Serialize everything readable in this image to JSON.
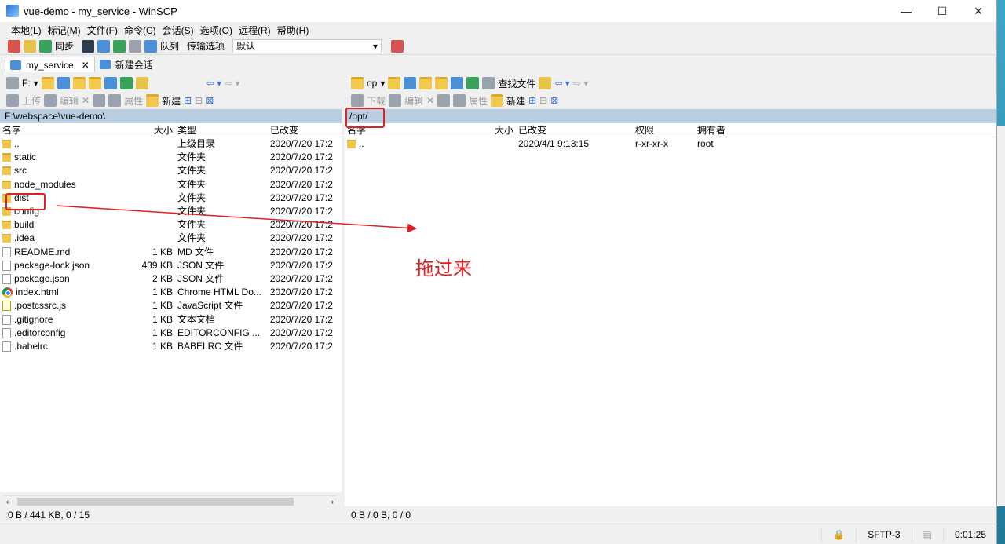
{
  "window": {
    "title": "vue-demo - my_service - WinSCP",
    "minimize": "—",
    "maximize": "☐",
    "close": "✕"
  },
  "menu": [
    "本地(L)",
    "标记(M)",
    "文件(F)",
    "命令(C)",
    "会话(S)",
    "选项(O)",
    "远程(R)",
    "帮助(H)"
  ],
  "toolbar": {
    "sync_label": "同步",
    "queue_label": "队列",
    "transfer_label": "传输选项",
    "transfer_value": "默认"
  },
  "tabs": [
    {
      "label": "my_service",
      "close": "✕"
    },
    {
      "label": "新建会话"
    }
  ],
  "left": {
    "drive": "F:",
    "upload": "上传",
    "edit": "编辑",
    "properties": "属性",
    "new": "新建",
    "path": "F:\\webspace\\vue-demo\\",
    "columns": [
      "名字",
      "大小",
      "类型",
      "已改变"
    ],
    "rows": [
      {
        "name": "..",
        "size": "",
        "type": "上级目录",
        "changed": "2020/7/20  17:2",
        "icon": "parent-icon"
      },
      {
        "name": "static",
        "size": "",
        "type": "文件夹",
        "changed": "2020/7/20  17:2",
        "icon": "folder-icon"
      },
      {
        "name": "src",
        "size": "",
        "type": "文件夹",
        "changed": "2020/7/20  17:2",
        "icon": "folder-icon"
      },
      {
        "name": "node_modules",
        "size": "",
        "type": "文件夹",
        "changed": "2020/7/20  17:2",
        "icon": "folder-icon"
      },
      {
        "name": "dist",
        "size": "",
        "type": "文件夹",
        "changed": "2020/7/20  17:2",
        "icon": "folder-icon"
      },
      {
        "name": "config",
        "size": "",
        "type": "文件夹",
        "changed": "2020/7/20  17:2",
        "icon": "folder-icon"
      },
      {
        "name": "build",
        "size": "",
        "type": "文件夹",
        "changed": "2020/7/20  17:2",
        "icon": "folder-icon"
      },
      {
        "name": ".idea",
        "size": "",
        "type": "文件夹",
        "changed": "2020/7/20  17:2",
        "icon": "folder-icon"
      },
      {
        "name": "README.md",
        "size": "1 KB",
        "type": "MD 文件",
        "changed": "2020/7/20  17:2",
        "icon": "file-icon"
      },
      {
        "name": "package-lock.json",
        "size": "439 KB",
        "type": "JSON 文件",
        "changed": "2020/7/20  17:2",
        "icon": "file-icon"
      },
      {
        "name": "package.json",
        "size": "2 KB",
        "type": "JSON 文件",
        "changed": "2020/7/20  17:2",
        "icon": "file-icon"
      },
      {
        "name": "index.html",
        "size": "1 KB",
        "type": "Chrome HTML Do...",
        "changed": "2020/7/20  17:2",
        "icon": "chrome-icon"
      },
      {
        "name": ".postcssrc.js",
        "size": "1 KB",
        "type": "JavaScript 文件",
        "changed": "2020/7/20  17:2",
        "icon": "js-file-icon"
      },
      {
        "name": ".gitignore",
        "size": "1 KB",
        "type": "文本文档",
        "changed": "2020/7/20  17:2",
        "icon": "file-icon"
      },
      {
        "name": ".editorconfig",
        "size": "1 KB",
        "type": "EDITORCONFIG ...",
        "changed": "2020/7/20  17:2",
        "icon": "file-icon"
      },
      {
        "name": ".babelrc",
        "size": "1 KB",
        "type": "BABELRC 文件",
        "changed": "2020/7/20  17:2",
        "icon": "file-icon"
      }
    ],
    "status": "0 B / 441 KB,   0 / 15"
  },
  "right": {
    "drive": "op",
    "find_files": "查找文件",
    "download": "下载",
    "edit": "编辑",
    "properties": "属性",
    "new": "新建",
    "path": "/opt/",
    "columns": [
      "名字",
      "大小",
      "已改变",
      "权限",
      "拥有者"
    ],
    "rows": [
      {
        "name": "..",
        "size": "",
        "changed": "2020/4/1 9:13:15",
        "rights": "r-xr-xr-x",
        "owner": "root"
      }
    ],
    "status": "0 B / 0 B,   0 / 0"
  },
  "bottom": {
    "protocol": "SFTP-3",
    "time": "0:01:25"
  },
  "annotation": {
    "text": "拖过来",
    "color": "#e02020"
  }
}
